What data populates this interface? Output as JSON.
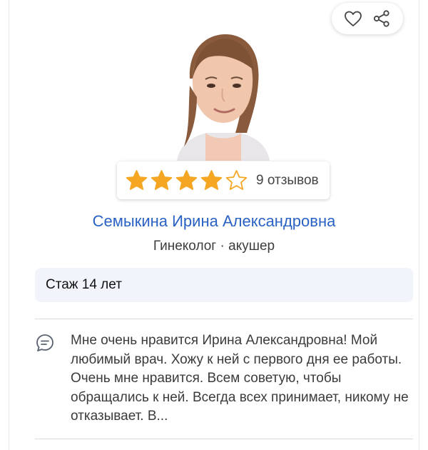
{
  "doctor": {
    "name": "Семыкина Ирина Александровна",
    "specialty": "Гинеколог · акушер",
    "experience": "Стаж 14 лет"
  },
  "rating": {
    "stars_filled": 4,
    "stars_total": 5,
    "reviews_label": "9 отзывов"
  },
  "review": {
    "text": "Мне очень нравится Ирина Александровна! Мой любимый врач. Хожу к ней с первого дня ее работы. Очень мне нравится. Всем советую, чтобы обращались к ней. Всегда всех принимает, никому не отказывает. В..."
  },
  "icons": {
    "favorite": "heart-icon",
    "share": "share-icon",
    "review": "speech-bubble-icon"
  },
  "colors": {
    "star": "#f5a623",
    "name_link": "#2a62c4",
    "experience_bg": "#f1f5fb"
  }
}
